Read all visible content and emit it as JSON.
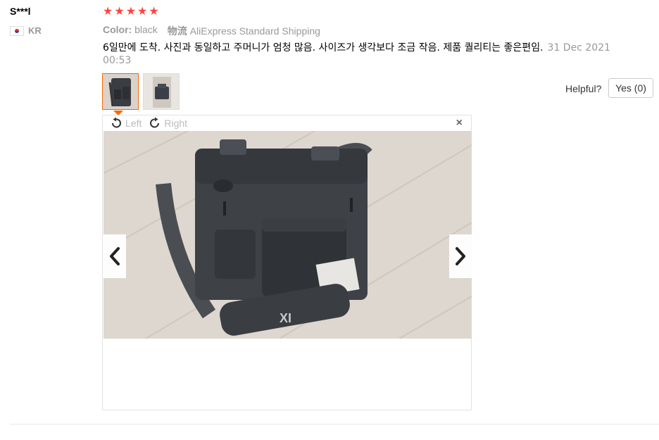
{
  "review": {
    "user": "S***l",
    "country": "KR",
    "rating": 5,
    "color_label": "Color:",
    "color_value": "black",
    "shipping_label": "物流",
    "shipping_value": "AliExpress Standard Shipping",
    "text": "6일만에 도착. 사진과 동일하고 주머니가 엄청 많음. 사이즈가 생각보다 조금 작음. 제품 퀄리티는 좋은편임.",
    "date": "31 Dec 2021 00:53",
    "helpful_label": "Helpful?",
    "yes_label": "Yes (0)"
  },
  "viewer": {
    "rotate_left": "Left",
    "rotate_right": "Right",
    "close": "×"
  },
  "colors": {
    "star": "#ff4444",
    "accent": "#ff6600"
  },
  "icons": {
    "rotate_left": "rotate-left-icon",
    "rotate_right": "rotate-right-icon",
    "close": "close-icon",
    "prev": "chevron-left-icon",
    "next": "chevron-right-icon"
  }
}
